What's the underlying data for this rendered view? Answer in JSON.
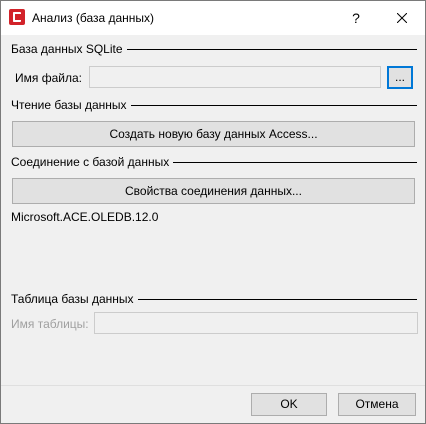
{
  "window": {
    "title": "Анализ (база данных)",
    "help_glyph": "?",
    "app_icon": "app-logo-icon",
    "close_icon": "close-icon"
  },
  "sqlite_group": {
    "title": "База данных SQLite",
    "file_label": "Имя файла:",
    "file_value": "",
    "browse_label": "..."
  },
  "read_group": {
    "title": "Чтение базы данных",
    "create_button": "Создать новую базу данных  Access..."
  },
  "connection_group": {
    "title": "Соединение с базой данных",
    "properties_button": "Свойства соединения данных...",
    "provider_text": "Microsoft.ACE.OLEDB.12.0"
  },
  "table_group": {
    "title": "Таблица базы данных",
    "table_label": "Имя таблицы:",
    "table_value": ""
  },
  "footer": {
    "ok_label": "OK",
    "cancel_label": "Отмена"
  },
  "colors": {
    "accent": "#0078d7",
    "app_icon": "#d2232a",
    "disabled_text": "#a0a0a0"
  }
}
